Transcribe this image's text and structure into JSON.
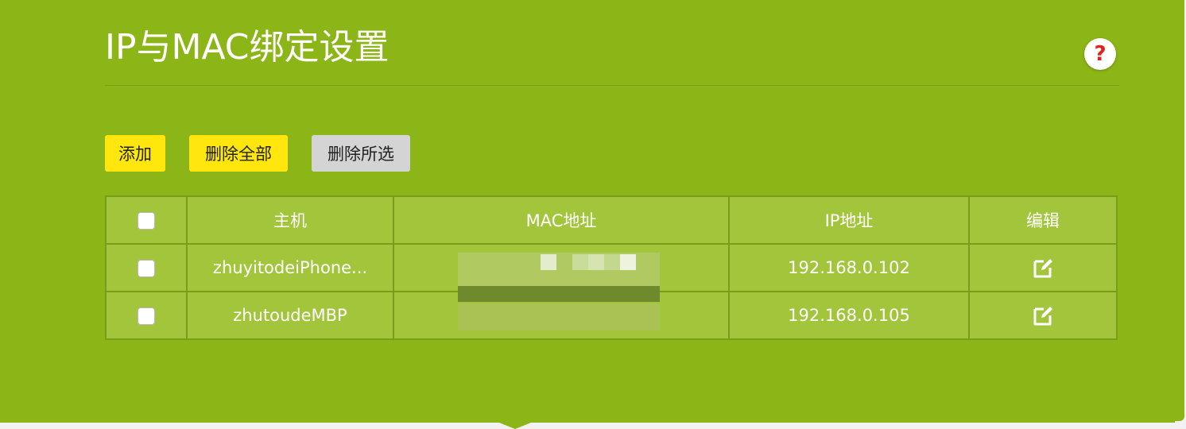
{
  "page": {
    "title": "IP与MAC绑定设置",
    "help_symbol": "?"
  },
  "toolbar": {
    "add_label": "添加",
    "delete_all_label": "删除全部",
    "delete_selected_label": "删除所选"
  },
  "table": {
    "headers": {
      "host": "主机",
      "mac": "MAC地址",
      "ip": "IP地址",
      "edit": "编辑"
    },
    "rows": [
      {
        "host": "zhuyitodeiPhone...",
        "mac": "",
        "ip": "192.168.0.102"
      },
      {
        "host": "zhutoudeMBP",
        "mac": "",
        "ip": "192.168.0.105"
      }
    ]
  },
  "colors": {
    "panel_bg": "#8cb518",
    "table_bg": "#a3c53c",
    "primary_button": "#ffe60d",
    "secondary_button": "#d4d4d4",
    "help_icon": "#e0211c"
  },
  "icons": {
    "help": "question-mark-icon",
    "edit": "edit-icon",
    "checkbox": "checkbox-icon"
  }
}
